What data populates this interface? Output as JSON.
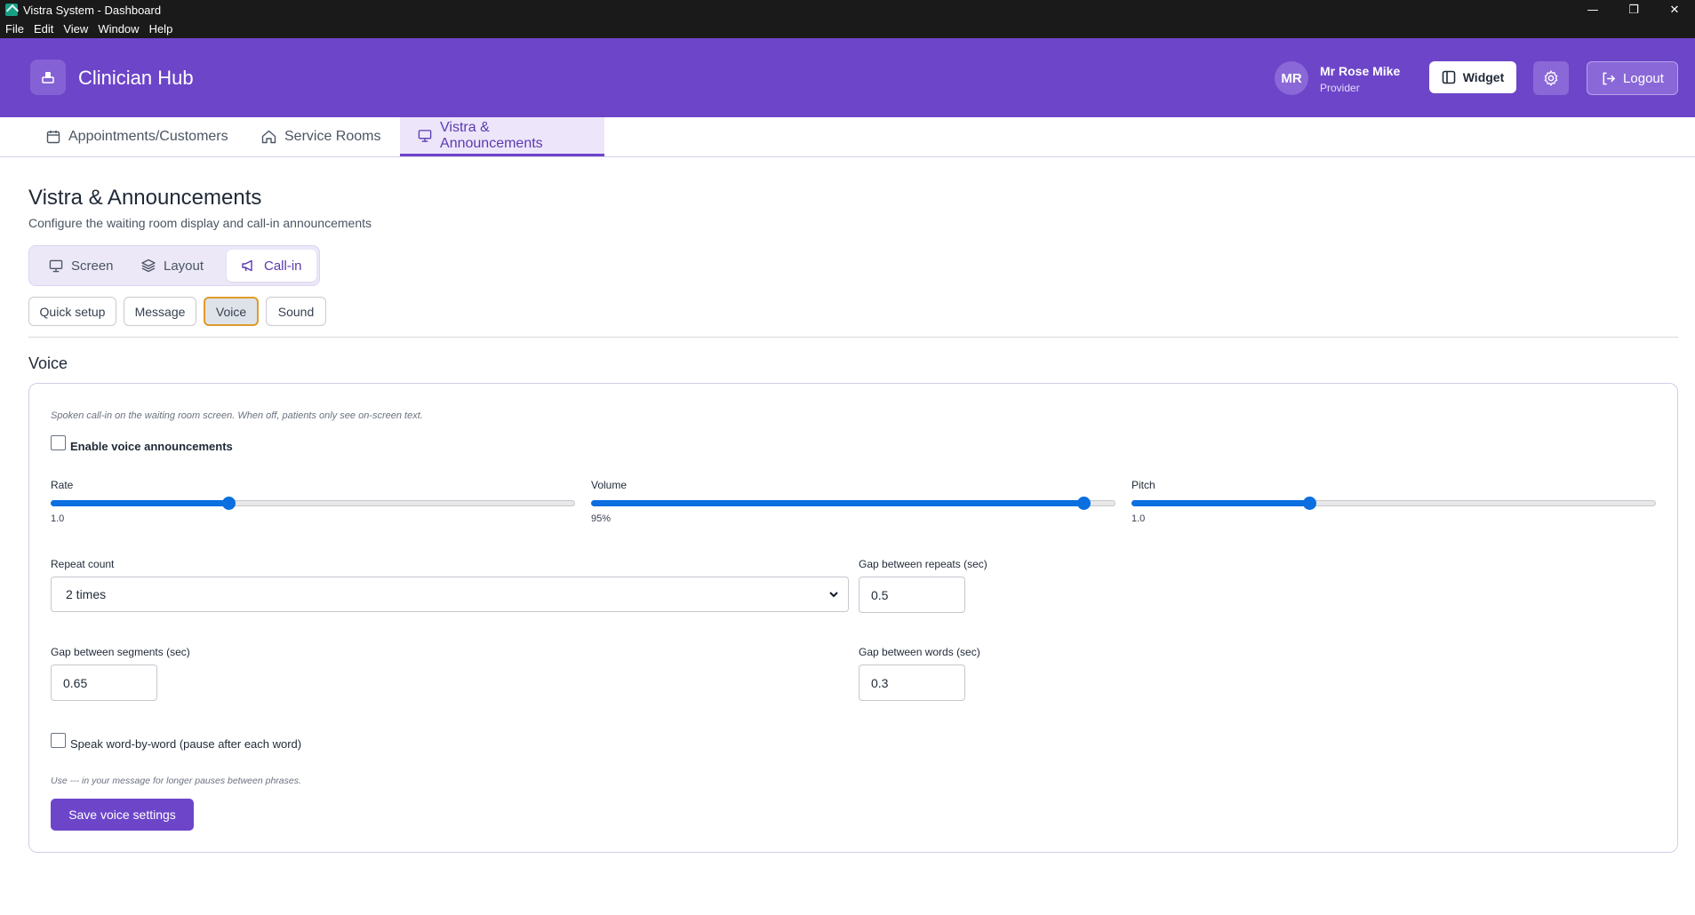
{
  "window": {
    "title": "Vistra System - Dashboard",
    "menu": [
      "File",
      "Edit",
      "View",
      "Window",
      "Help"
    ]
  },
  "header": {
    "brand": "Clinician Hub",
    "user": {
      "initials": "MR",
      "name": "Mr Rose Mike",
      "role": "Provider"
    },
    "widget_label": "Widget",
    "logout_label": "Logout"
  },
  "main_tabs": [
    {
      "label": "Appointments/Customers",
      "icon": "calendar-icon"
    },
    {
      "label": "Service Rooms",
      "icon": "home-icon"
    },
    {
      "label": "Vistra & Announcements",
      "icon": "monitor-icon",
      "active": true
    }
  ],
  "page": {
    "title": "Vistra & Announcements",
    "subtitle": "Configure the waiting room display and call-in announcements"
  },
  "segment_tabs": [
    {
      "label": "Screen",
      "icon": "monitor-icon"
    },
    {
      "label": "Layout",
      "icon": "layers-icon"
    },
    {
      "label": "Call-in",
      "icon": "megaphone-icon",
      "active": true
    }
  ],
  "sub_tabs": [
    {
      "label": "Quick setup"
    },
    {
      "label": "Message"
    },
    {
      "label": "Voice",
      "active": true
    },
    {
      "label": "Sound"
    }
  ],
  "voice": {
    "section_title": "Voice",
    "hint": "Spoken call-in on the waiting room screen. When off, patients only see on-screen text.",
    "enable_label": "Enable voice announcements",
    "enable_checked": false,
    "sliders": [
      {
        "label": "Rate",
        "value_text": "1.0",
        "fraction": 0.338
      },
      {
        "label": "Volume",
        "value_text": "95%",
        "fraction": 0.94
      },
      {
        "label": "Pitch",
        "value_text": "1.0",
        "fraction": 0.338
      }
    ],
    "repeat_count": {
      "label": "Repeat count",
      "value": "2 times"
    },
    "gap_repeats": {
      "label": "Gap between repeats (sec)",
      "value": "0.5"
    },
    "gap_segments": {
      "label": "Gap between segments (sec)",
      "value": "0.65"
    },
    "gap_words": {
      "label": "Gap between words (sec)",
      "value": "0.3"
    },
    "word_by_word_label": "Speak word-by-word (pause after each word)",
    "word_by_word_checked": false,
    "pause_hint": "Use --- in your message for longer pauses between phrases.",
    "save_label": "Save voice settings"
  },
  "colors": {
    "brand_purple": "#6d45c9",
    "slider_blue": "#0b6fe0",
    "active_outline": "#e09a2b"
  }
}
